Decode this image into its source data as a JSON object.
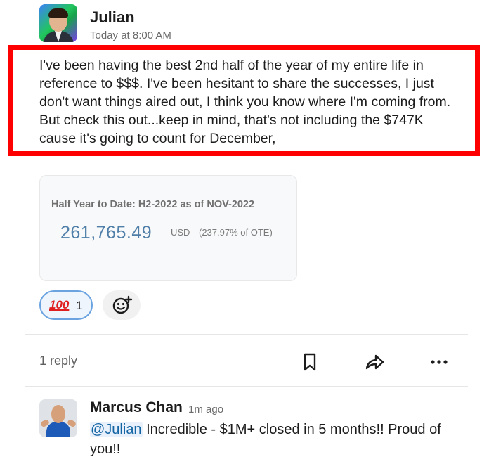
{
  "message": {
    "author": "Julian",
    "timestamp": "Today at 8:00 AM",
    "text": "I've been having the best 2nd half of the year of my entire life in reference to $$$. I've been hesitant to share the successes, I just don't want things aired out, I think you know where I'm coming from.  But check this out...keep in mind, that's not including the $747K cause it's going to count for December,"
  },
  "attachment": {
    "title": "Half Year to Date: H2-2022 as of NOV-2022",
    "value": "261,765.49",
    "unit": "USD",
    "percent_text": "(237.97% of OTE)"
  },
  "reactions": [
    {
      "emoji": "💯",
      "emoji_text": "100",
      "count": "1"
    }
  ],
  "thread": {
    "replies_label": "1 reply"
  },
  "reply": {
    "author": "Marcus Chan",
    "timestamp": "1m ago",
    "mention": "@Julian",
    "text": " Incredible - $1M+ closed in 5 months!! Proud of you!!"
  },
  "colors": {
    "highlight_box": "#ff0000",
    "value_blue": "#4f7fa8",
    "mention_blue": "#1264a3",
    "reaction_border": "#6aa3e0"
  },
  "icons": [
    "bookmark-icon",
    "share-icon",
    "more-icon",
    "add-reaction-icon"
  ]
}
